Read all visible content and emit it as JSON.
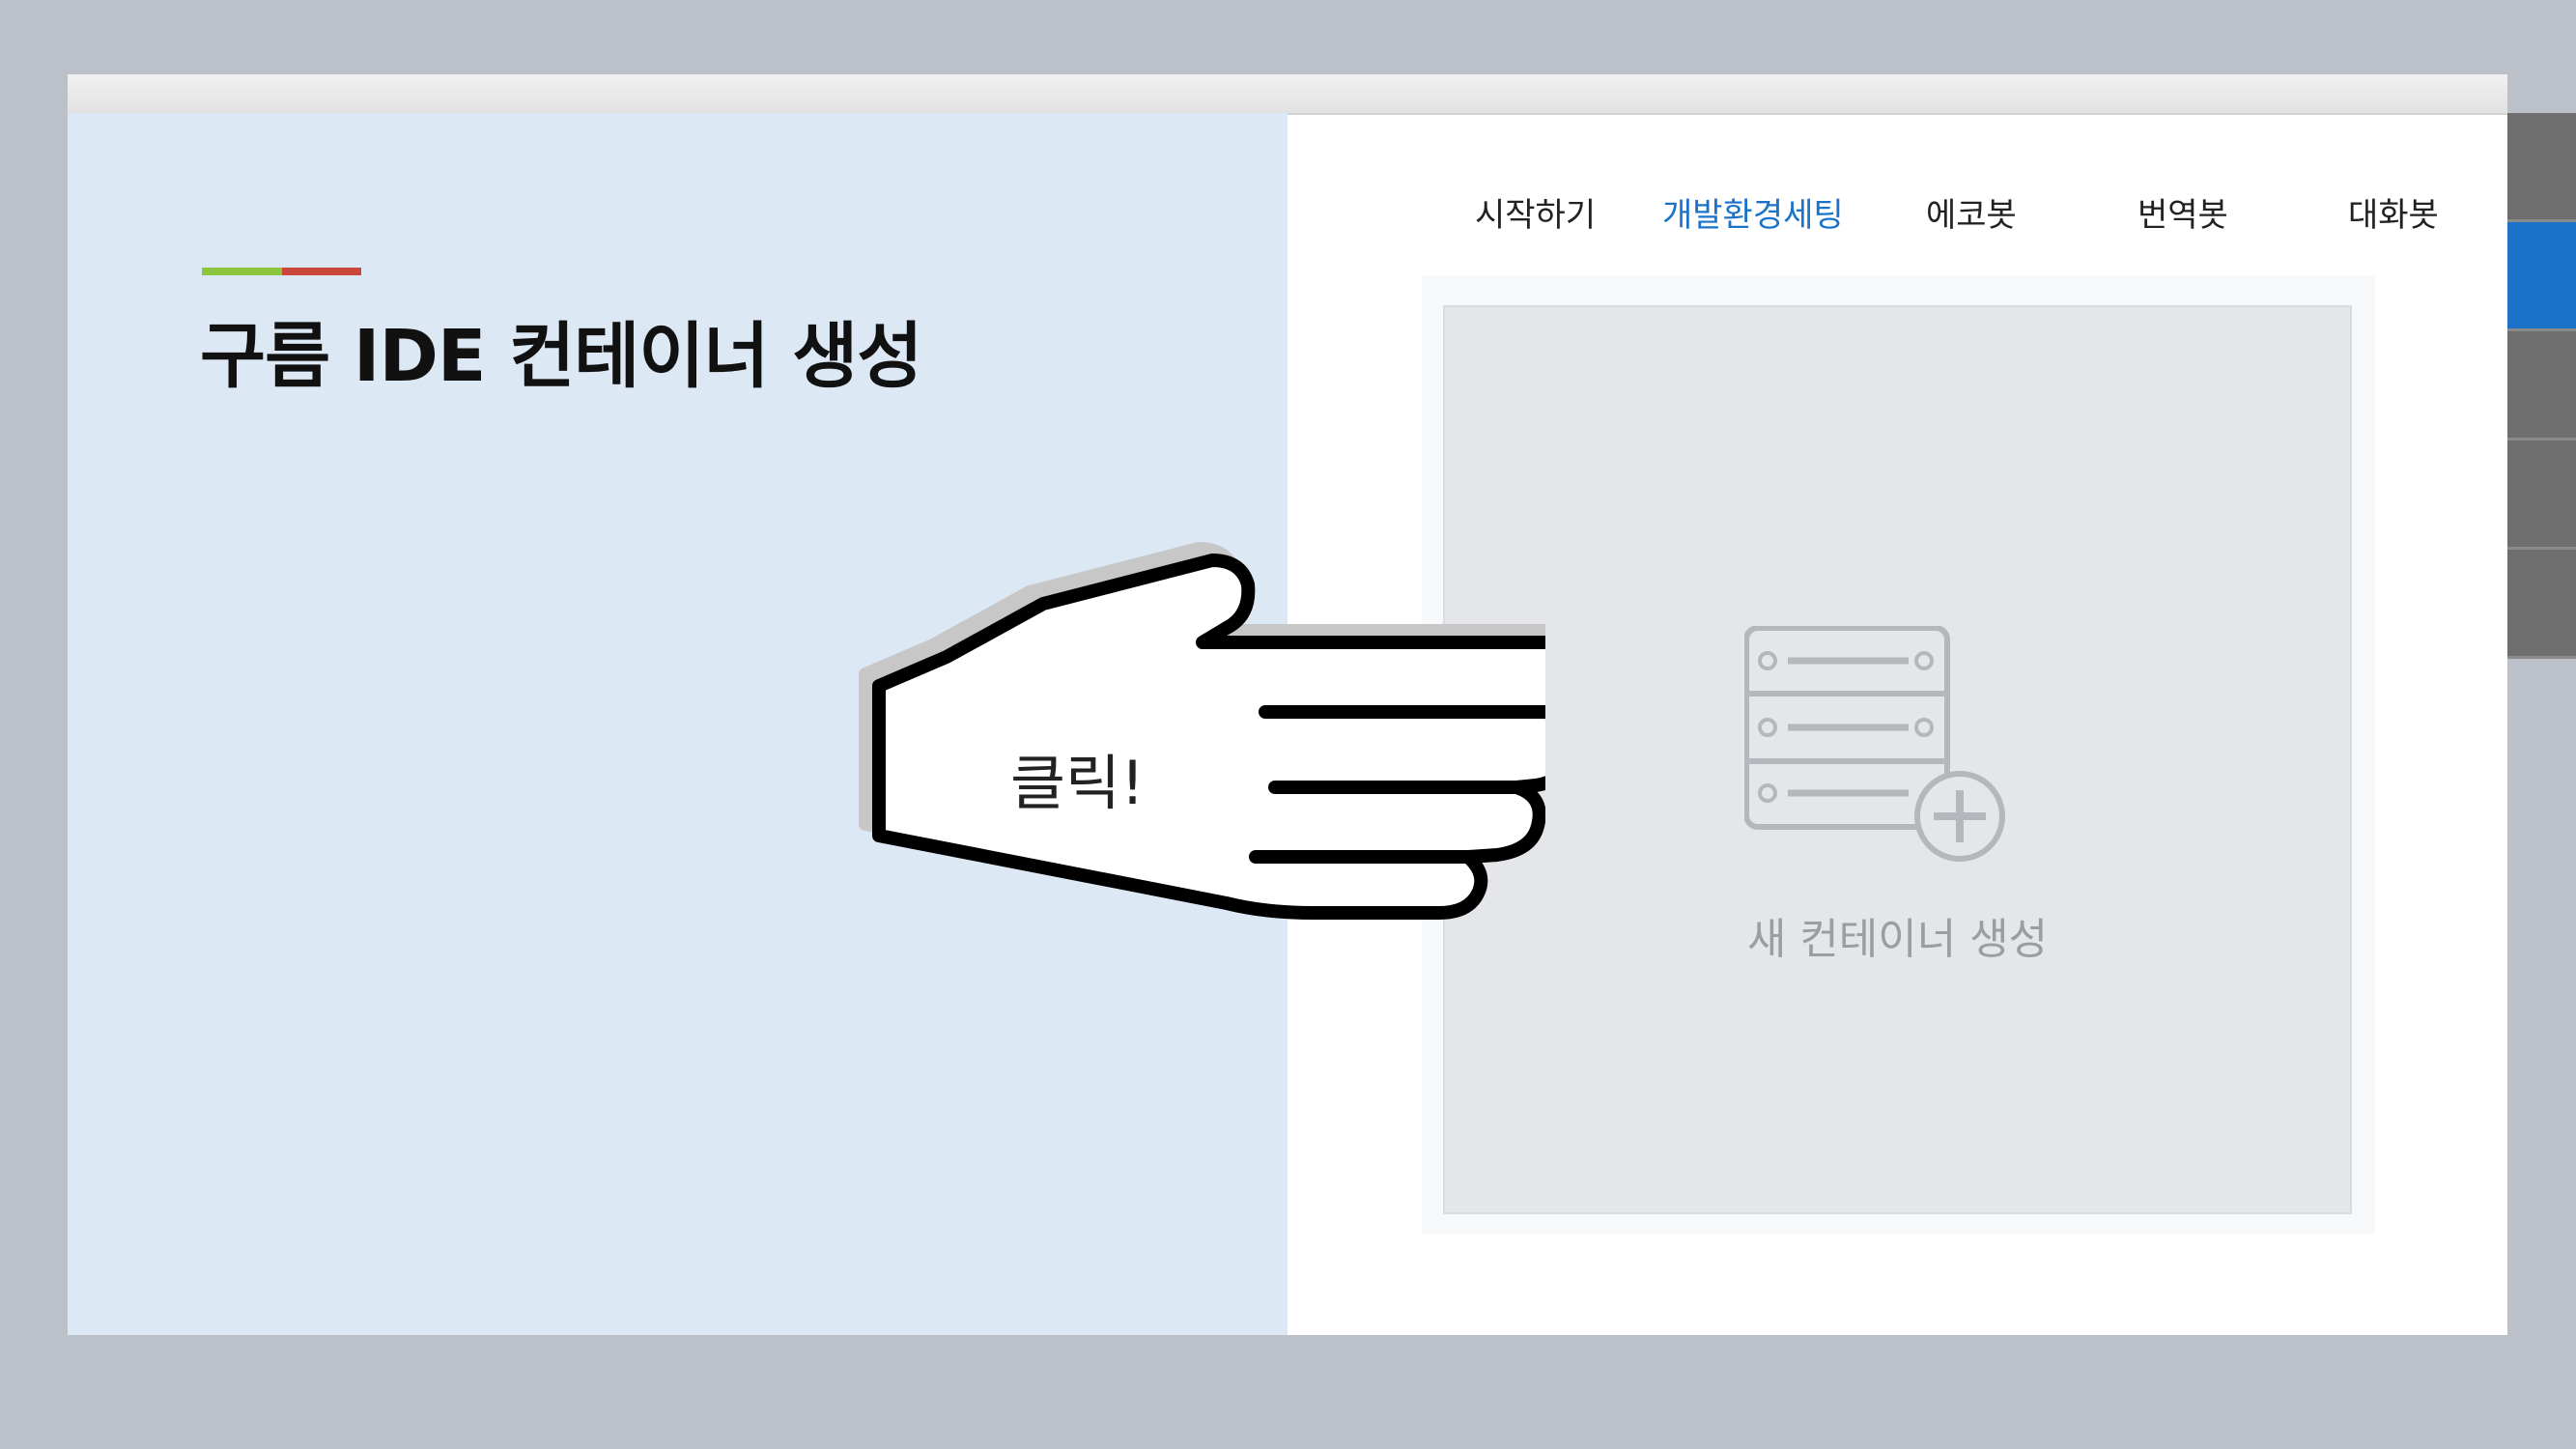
{
  "page": {
    "title": "구름 IDE 컨테이너 생성"
  },
  "nav": {
    "items": [
      {
        "label": "시작하기"
      },
      {
        "label": "개발환경세팅",
        "active": true
      },
      {
        "label": "에코봇"
      },
      {
        "label": "번역봇"
      },
      {
        "label": "대화봇"
      }
    ]
  },
  "card": {
    "label": "새 컨테이너 생성",
    "icon": "server-add-icon"
  },
  "callout": {
    "text": "클릭!",
    "icon": "pointing-hand-icon"
  },
  "colors": {
    "accent_green": "#8cc63f",
    "accent_red": "#c9483b",
    "active_nav": "#1a73c8",
    "left_panel": "#dde8f5",
    "side_tab": "#6e6e6e",
    "side_tab_active": "#1a73c8"
  },
  "side_tabs": {
    "count": 5,
    "active_index": 1
  }
}
